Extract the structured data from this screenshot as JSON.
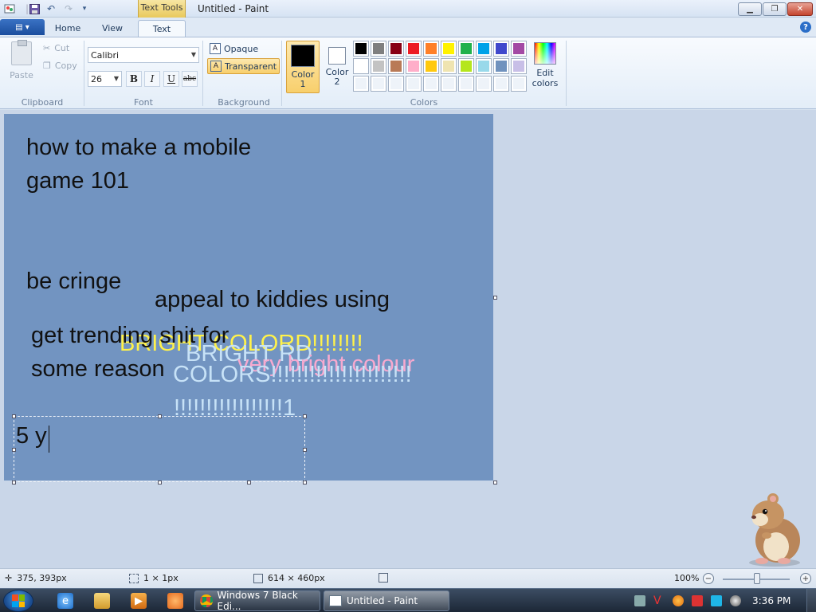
{
  "window": {
    "title": "Untitled - Paint",
    "context_tab": "Text Tools"
  },
  "tabs": {
    "file": "▤ ▾",
    "home": "Home",
    "view": "View",
    "text": "Text"
  },
  "clipboard": {
    "paste": "Paste",
    "cut": "Cut",
    "copy": "Copy",
    "label": "Clipboard"
  },
  "font": {
    "family": "Calibri",
    "size": "26",
    "bold": "B",
    "italic": "I",
    "underline": "U",
    "strike": "abc",
    "label": "Font"
  },
  "background": {
    "opaque": "Opaque",
    "transparent": "Transparent",
    "label": "Background"
  },
  "colors": {
    "color1_label": "Color\n1",
    "color2_label": "Color\n2",
    "color1": "#000000",
    "color2": "#ffffff",
    "edit": "Edit colors",
    "label": "Colors",
    "palette_row1": [
      "#000000",
      "#7f7f7f",
      "#880015",
      "#ed1c24",
      "#ff7f27",
      "#fff200",
      "#22b14c",
      "#00a2e8",
      "#3f48cc",
      "#a349a4"
    ],
    "palette_row2": [
      "#ffffff",
      "#c3c3c3",
      "#b97a57",
      "#ffaec9",
      "#ffc90e",
      "#efe4b0",
      "#b5e61d",
      "#99d9ea",
      "#7092be",
      "#c8bfe7"
    ],
    "palette_row3": [
      "#ffffff",
      "#ffffff",
      "#ffffff",
      "#ffffff",
      "#ffffff",
      "#ffffff",
      "#ffffff",
      "#ffffff",
      "#ffffff",
      "#ffffff"
    ]
  },
  "canvas": {
    "background": "#7294c1",
    "lines": [
      {
        "text": "how to make a mobile",
        "color": "#111111"
      },
      {
        "text": "game 101",
        "color": "#111111"
      },
      {
        "text": "be cringe",
        "color": "#111111"
      },
      {
        "text": "appeal to kiddies using",
        "color": "#111111"
      },
      {
        "text": "get trending shit for",
        "color": "#111111"
      },
      {
        "text": "some reason",
        "color": "#111111"
      },
      {
        "text": "BRIGHT COLORD!!!!!!!!",
        "color": "#fff24a"
      },
      {
        "text": "BRIGHT RD",
        "color": "#c7e2f7"
      },
      {
        "text": "very bright colour",
        "color": "#f7a9cf"
      },
      {
        "text": "COLORS!!!!!!!!!!!!!!!!!!!!!!",
        "color": "#c7e2f7"
      },
      {
        "text": "!!!!!!!!!!!!!!!!!1",
        "color": "#c7e2f7"
      },
      {
        "text": "5 y",
        "color": "#111111"
      }
    ]
  },
  "status": {
    "cursor_pos": "375, 393px",
    "selection_size": "1 × 1px",
    "canvas_size": "614 × 460px",
    "zoom": "100%",
    "zoom_level": 1.0
  },
  "taskbar": {
    "chrome_task": "Windows 7 Black Edi...",
    "paint_task": "Untitled - Paint",
    "clock": "3:36 PM"
  }
}
